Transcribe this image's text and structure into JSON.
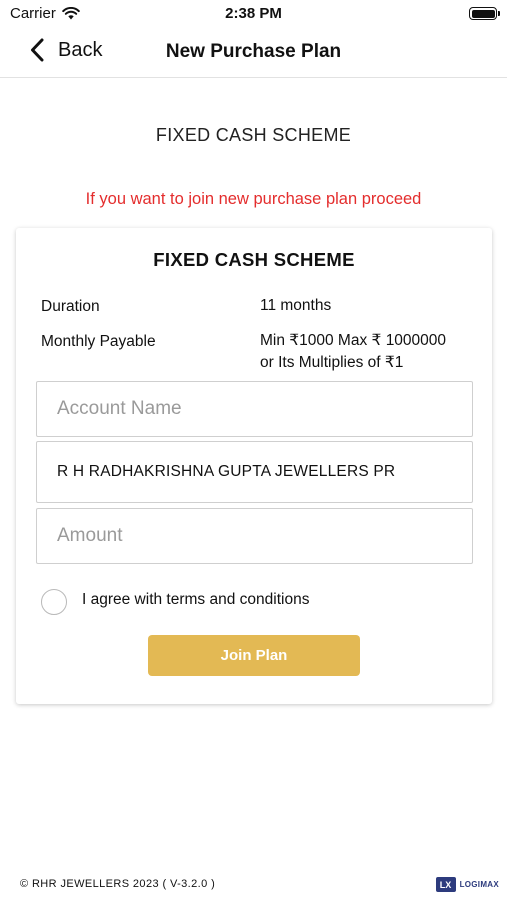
{
  "status_bar": {
    "carrier": "Carrier",
    "time": "2:38 PM",
    "icons": [
      "wifi-icon",
      "battery-icon"
    ]
  },
  "nav": {
    "back_label": "Back",
    "title": "New Purchase Plan",
    "back_icon": "chevron-left-icon"
  },
  "scheme_heading": "FIXED CASH SCHEME",
  "join_message": "If you want to join new purchase plan proceed",
  "card": {
    "title": "FIXED CASH SCHEME",
    "duration_label": "Duration",
    "duration_value": "11 months",
    "monthly_label": "Monthly Payable",
    "monthly_value_line1": "Min ₹1000 Max ₹ 1000000",
    "monthly_value_line2": "or Its Multiplies of ₹1",
    "account_name_placeholder": "Account Name",
    "account_holder": "R H RADHAKRISHNA GUPTA JEWELLERS PR",
    "amount_placeholder": "Amount",
    "agree_label": "I agree with terms and conditions",
    "agree_checked": false,
    "join_button": "Join Plan"
  },
  "footer": {
    "copyright": "© RHR JEWELLERS 2023 ( V-3.2.0 )",
    "logo_mark": "LX",
    "logo_text": "LOGIMAX"
  },
  "colors": {
    "accent_gold": "#e3b954",
    "message_red": "#e42d2d",
    "logo_blue": "#2d3b7d"
  }
}
